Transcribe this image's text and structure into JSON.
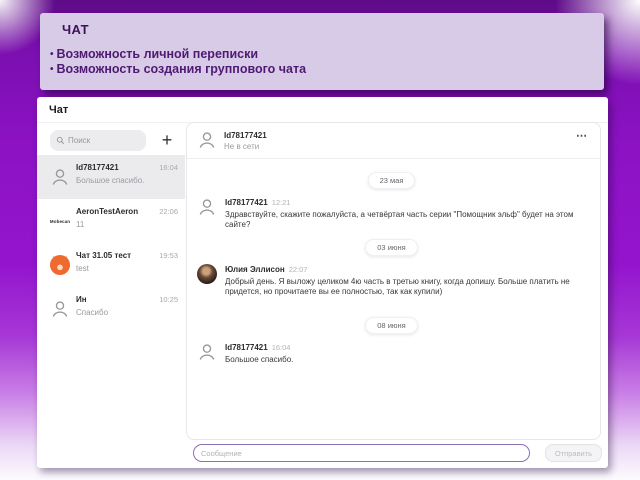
{
  "slide": {
    "title": "ЧАТ",
    "bullets": [
      "Возможность личной переписки",
      "Возможность создания группового чата"
    ],
    "bullet_glyph": "•"
  },
  "app": {
    "window_title": "Чат",
    "sidebar": {
      "search_placeholder": "Поиск",
      "add_button_glyph": "+",
      "conversations": [
        {
          "name": "Id78177421",
          "time": "16:04",
          "preview": "Большое спасибо.",
          "avatar": "person-icon",
          "selected": true
        },
        {
          "name": "AeronTestAeron",
          "time": "22:06",
          "preview": "11",
          "avatar": "mobecan-logo",
          "avatar_text": "Mobecan",
          "selected": false
        },
        {
          "name": "Чат 31.05 тест",
          "time": "19:53",
          "preview": "test",
          "avatar": "fox-image",
          "selected": false
        },
        {
          "name": "Ин",
          "time": "10:25",
          "preview": "Спасибо",
          "avatar": "person-icon",
          "selected": false
        }
      ]
    },
    "conversation": {
      "peer_name": "Id78177421",
      "peer_status": "Не в сети",
      "menu_glyph": "⋯",
      "feed": [
        {
          "type": "date",
          "label": "23 мая"
        },
        {
          "type": "message",
          "author": "Id78177421",
          "time": "12:21",
          "avatar": "person-icon",
          "text": "Здравствуйте, скажите пожалуйста, а четвёртая часть серии \"Помощник эльф\" будет на этом сайте?"
        },
        {
          "type": "date",
          "label": "03 июня"
        },
        {
          "type": "message",
          "author": "Юлия Эллисон",
          "time": "22:07",
          "avatar": "user-photo",
          "text": "Добрый день. Я выложу целиком 4ю часть в третью книгу, когда допишу. Больше платить не придется, но прочитаете вы ее полностью, так как купили)"
        },
        {
          "type": "date",
          "label": "08 июня"
        },
        {
          "type": "message",
          "author": "Id78177421",
          "time": "16:04",
          "avatar": "person-icon",
          "text": "Большое спасибо."
        }
      ]
    },
    "composer": {
      "placeholder": "Сообщение",
      "send_label": "Отправить"
    }
  },
  "colors": {
    "background_purple": "#9414cd",
    "slide_card_bg": "#d8cbe8",
    "slide_text": "#4f1a72",
    "composer_border": "#8d6fb8",
    "selected_item_bg": "#ebebee",
    "fox_orange": "#ef6a2f"
  }
}
